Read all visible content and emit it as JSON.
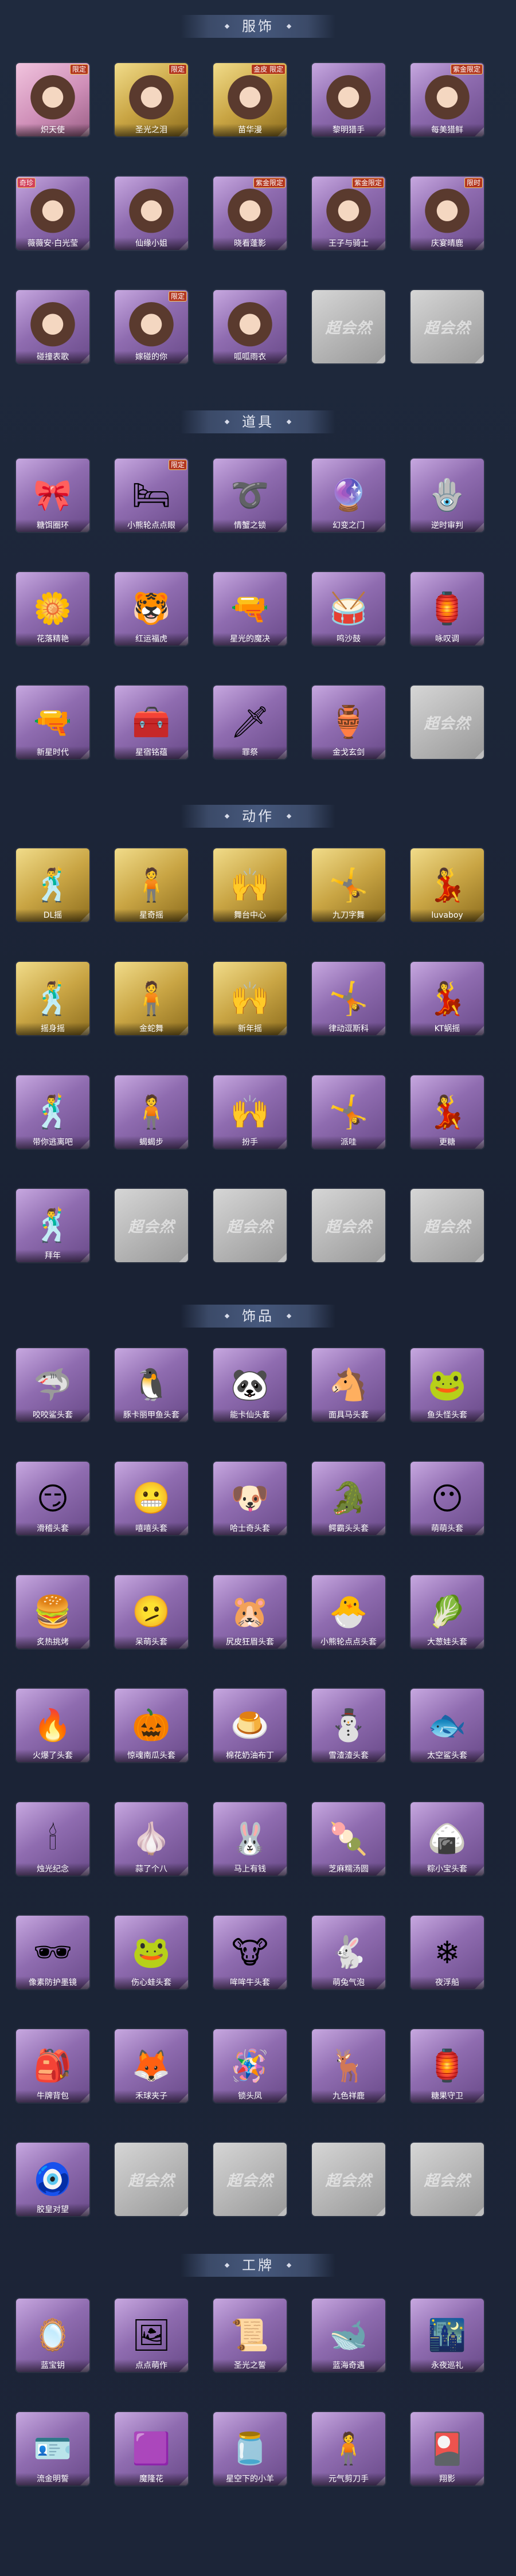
{
  "sections": [
    {
      "key": "outfits",
      "title": "服饰",
      "rows": [
        [
          {
            "label": "炽天使",
            "style": "pink",
            "badge": "限定",
            "badge_pos": "right"
          },
          {
            "label": "圣光之泪",
            "style": "gold",
            "badge": "限定"
          },
          {
            "label": "苗华漫",
            "style": "gold",
            "badge": "金皮 限定"
          },
          {
            "label": "黎明猎手",
            "style": "purple"
          },
          {
            "label": "每美猎鲜",
            "style": "purple",
            "badge": "紫金限定"
          }
        ],
        [
          {
            "label": "薇薇安·白光莹",
            "style": "purple",
            "badge": "奇珍",
            "badge_pos": "left"
          },
          {
            "label": "仙缘小姐",
            "style": "purple"
          },
          {
            "label": "晓看蓬影",
            "style": "purple",
            "badge": "紫金限定"
          },
          {
            "label": "王子与骑士",
            "style": "purple",
            "badge": "紫金限定"
          },
          {
            "label": "庆宴晴鹿",
            "style": "purple",
            "badge": "限时"
          }
        ],
        [
          {
            "label": "碰撞表歌",
            "style": "purple"
          },
          {
            "label": "嫁碰的你",
            "style": "purple",
            "badge": "限定"
          },
          {
            "label": "呱呱雨衣",
            "style": "purple"
          },
          {
            "label": "",
            "style": "empty"
          },
          {
            "label": "",
            "style": "empty"
          }
        ]
      ]
    },
    {
      "key": "props",
      "title": "道具",
      "rows": [
        [
          {
            "label": "糖饵圈环",
            "style": "purple",
            "icon": "🎀"
          },
          {
            "label": "小熊轮点点眼",
            "style": "purple",
            "icon": "🛏",
            "badge": "限定"
          },
          {
            "label": "情蟹之锁",
            "style": "purple",
            "icon": "➰"
          },
          {
            "label": "幻变之门",
            "style": "purple",
            "icon": "🔮"
          },
          {
            "label": "逆时审判",
            "style": "purple",
            "icon": "🪬"
          }
        ],
        [
          {
            "label": "花落精艳",
            "style": "purple",
            "icon": "🌼"
          },
          {
            "label": "红运福虎",
            "style": "purple",
            "icon": "🐯"
          },
          {
            "label": "星光的魔决",
            "style": "purple",
            "icon": "🔫"
          },
          {
            "label": "鸣沙鼓",
            "style": "purple",
            "icon": "🥁"
          },
          {
            "label": "咏叹调",
            "style": "purple",
            "icon": "🏮"
          }
        ],
        [
          {
            "label": "新星时代",
            "style": "purple",
            "icon": "🔫"
          },
          {
            "label": "星宿铭蕴",
            "style": "purple",
            "icon": "🧰"
          },
          {
            "label": "罪祭",
            "style": "purple",
            "icon": "🗡"
          },
          {
            "label": "金戈玄剑",
            "style": "purple",
            "icon": "🏺"
          },
          {
            "label": "",
            "style": "empty"
          }
        ]
      ]
    },
    {
      "key": "actions",
      "title": "动作",
      "rows": [
        [
          {
            "label": "DL摇",
            "style": "gold"
          },
          {
            "label": "星奇摇",
            "style": "gold"
          },
          {
            "label": "舞台中心",
            "style": "gold"
          },
          {
            "label": "九刀字舞",
            "style": "gold"
          },
          {
            "label": "luvaboy",
            "style": "gold"
          }
        ],
        [
          {
            "label": "摇身摇",
            "style": "gold"
          },
          {
            "label": "金蛇舞",
            "style": "gold"
          },
          {
            "label": "新年摇",
            "style": "gold"
          },
          {
            "label": "律动逗斯科",
            "style": "purple"
          },
          {
            "label": "KT蜗摇",
            "style": "purple"
          }
        ],
        [
          {
            "label": "带你逃离吧",
            "style": "purple"
          },
          {
            "label": "蝎蝎步",
            "style": "purple"
          },
          {
            "label": "扮手",
            "style": "purple"
          },
          {
            "label": "派哇",
            "style": "purple"
          },
          {
            "label": "更糖",
            "style": "purple"
          }
        ],
        [
          {
            "label": "拜年",
            "style": "purple"
          },
          {
            "label": "",
            "style": "empty"
          },
          {
            "label": "",
            "style": "empty"
          },
          {
            "label": "",
            "style": "empty"
          },
          {
            "label": "",
            "style": "empty"
          }
        ]
      ]
    },
    {
      "key": "accessories",
      "title": "饰品",
      "rows": [
        [
          {
            "label": "咬咬鲨头套",
            "style": "purple",
            "icon": "🦈"
          },
          {
            "label": "豚卡丽甲鱼头套",
            "style": "purple",
            "icon": "🐧"
          },
          {
            "label": "能卡仙头套",
            "style": "purple",
            "icon": "🐼"
          },
          {
            "label": "面具马头套",
            "style": "purple",
            "icon": "🐴"
          },
          {
            "label": "鱼头怪头套",
            "style": "purple",
            "icon": "🐸"
          }
        ],
        [
          {
            "label": "滑稽头套",
            "style": "purple",
            "icon": "😏"
          },
          {
            "label": "嘻嘻头套",
            "style": "purple",
            "icon": "😬"
          },
          {
            "label": "哈士奇头套",
            "style": "purple",
            "icon": "🐶"
          },
          {
            "label": "鳄霸头头套",
            "style": "purple",
            "icon": "🐊"
          },
          {
            "label": "萌萌头套",
            "style": "purple",
            "icon": "😶"
          }
        ],
        [
          {
            "label": "炙热挑烤",
            "style": "purple",
            "icon": "🍔"
          },
          {
            "label": "呆萌头套",
            "style": "purple",
            "icon": "🫤"
          },
          {
            "label": "尻皮狂眉头套",
            "style": "purple",
            "icon": "🐹"
          },
          {
            "label": "小熊轮点点头套",
            "style": "purple",
            "icon": "🐣"
          },
          {
            "label": "大葱娃头套",
            "style": "purple",
            "icon": "🥬"
          }
        ],
        [
          {
            "label": "火爆了头套",
            "style": "purple",
            "icon": "🔥"
          },
          {
            "label": "惊魂南瓜头套",
            "style": "purple",
            "icon": "🎃"
          },
          {
            "label": "棉花奶油布丁",
            "style": "purple",
            "icon": "🍮"
          },
          {
            "label": "雪渣渣头套",
            "style": "purple",
            "icon": "⛄"
          },
          {
            "label": "太空鲨头套",
            "style": "purple",
            "icon": "🐟"
          }
        ],
        [
          {
            "label": "烛光纪念",
            "style": "purple",
            "icon": "🕯"
          },
          {
            "label": "蒜了个八",
            "style": "purple",
            "icon": "🧄"
          },
          {
            "label": "马上有钱",
            "style": "purple",
            "icon": "🐰"
          },
          {
            "label": "芝麻糯汤圆",
            "style": "purple",
            "icon": "🍡"
          },
          {
            "label": "粽小宝头套",
            "style": "purple",
            "icon": "🍙"
          }
        ],
        [
          {
            "label": "像素防护墨镜",
            "style": "purple",
            "icon": "🕶"
          },
          {
            "label": "伤心蛙头套",
            "style": "purple",
            "icon": "🐸"
          },
          {
            "label": "哞哞牛头套",
            "style": "purple",
            "icon": "🐮"
          },
          {
            "label": "萌兔气泡",
            "style": "purple",
            "icon": "🐇"
          },
          {
            "label": "夜浮船",
            "style": "purple",
            "icon": "❄"
          }
        ],
        [
          {
            "label": "牛牌背包",
            "style": "purple",
            "icon": "🎒"
          },
          {
            "label": "禾球夹子",
            "style": "purple",
            "icon": "🦊"
          },
          {
            "label": "锁头凤",
            "style": "purple",
            "icon": "🪅"
          },
          {
            "label": "九色祥鹿",
            "style": "purple",
            "icon": "🦌"
          },
          {
            "label": "糖果守卫",
            "style": "purple",
            "icon": "🏮"
          }
        ],
        [
          {
            "label": "胶皇对望",
            "style": "purple",
            "icon": "🧿"
          },
          {
            "label": "",
            "style": "empty"
          },
          {
            "label": "",
            "style": "empty"
          },
          {
            "label": "",
            "style": "empty"
          },
          {
            "label": "",
            "style": "empty"
          }
        ]
      ]
    },
    {
      "key": "badges",
      "title": "工牌",
      "rows": [
        [
          {
            "label": "蓝宝钥",
            "style": "purple",
            "icon": "🪞"
          },
          {
            "label": "点点萌作",
            "style": "purple",
            "icon": "🖼"
          },
          {
            "label": "圣光之誓",
            "style": "purple",
            "icon": "📜"
          },
          {
            "label": "蓝海奇遇",
            "style": "purple",
            "icon": "🐋"
          },
          {
            "label": "永夜巡礼",
            "style": "purple",
            "icon": "🌃"
          }
        ],
        [
          {
            "label": "流金明誓",
            "style": "purple",
            "icon": "🪪"
          },
          {
            "label": "魔隆花",
            "style": "purple",
            "icon": "🟪"
          },
          {
            "label": "星空下的小羊",
            "style": "purple",
            "icon": "🫙"
          },
          {
            "label": "元气剪刀手",
            "style": "purple",
            "icon": "🧍"
          },
          {
            "label": "翔影",
            "style": "purple",
            "icon": "🎴"
          }
        ]
      ]
    }
  ],
  "empty_watermark": "超会然"
}
